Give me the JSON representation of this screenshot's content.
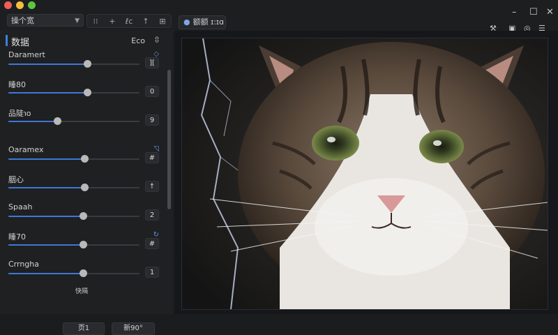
{
  "window": {
    "controls": {
      "minimize": "–",
      "maximize": "☐",
      "close": "✕"
    }
  },
  "toolbar": {
    "preset_select": "操个宽",
    "tools": [
      "⁝⁝",
      "+",
      "ℓc",
      "↑",
      "⊞"
    ]
  },
  "document_tab": {
    "icon": "users-icon",
    "label": "额额 ɪ:ɪɑ"
  },
  "right_tools": [
    "⚒",
    "▣",
    "◎",
    "☰"
  ],
  "panel": {
    "title": "数据",
    "mode_label": "Eco",
    "rows": [
      {
        "label": "Daramert",
        "badge": "◇",
        "value": "][",
        "level": 0.6
      },
      {
        "label": "睡80",
        "badge": "",
        "value": "0",
        "level": 0.6
      },
      {
        "label": "品陡℩o",
        "badge": "",
        "value": "9",
        "level": 0.37
      },
      {
        "label": "Oaramex",
        "badge": "◹",
        "value": "#",
        "level": 0.58
      },
      {
        "label": "胭心",
        "badge": "",
        "value": "↑",
        "level": 0.58
      },
      {
        "label": "Spaah",
        "badge": "",
        "value": "2",
        "level": 0.57
      },
      {
        "label": "睡70",
        "badge": "↻",
        "value": "#",
        "level": 0.57
      },
      {
        "label": "Crrngha",
        "badge": "",
        "value": "1",
        "level": 0.57
      }
    ],
    "mid_note": "快隔",
    "buttons": {
      "left": "页1",
      "right": "新90°"
    }
  },
  "canvas": {
    "subject": "tabby cat portrait with lightning"
  }
}
